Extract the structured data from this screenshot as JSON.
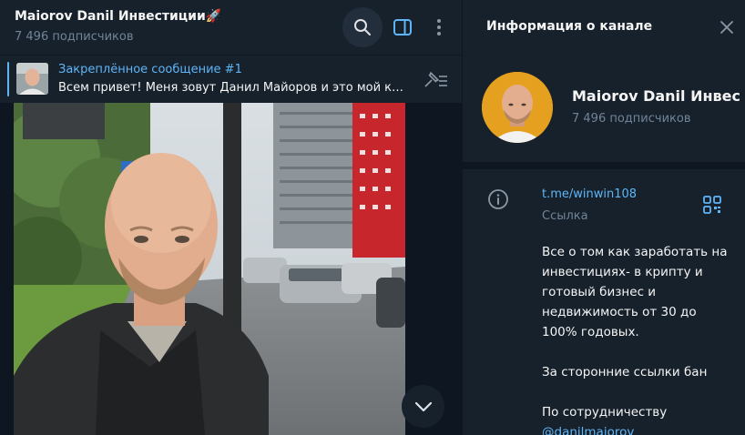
{
  "chat": {
    "title": "Maiorov Danil Инвестиции🚀",
    "subscribers": "7 496 подписчиков"
  },
  "pinned": {
    "title": "Закреплённое сообщение #1",
    "text": "Всем привет! Меня зовут Данил Майоров и это мой канал"
  },
  "info_panel": {
    "title": "Информация о канале",
    "name": "Maiorov Danil Инвестиции🚀",
    "subscribers": "7 496 подписчиков",
    "link": "t.me/winwin108",
    "link_label": "Ссылка",
    "description": [
      "Все о том как заработать на инвестициях- в крипту и готовый бизнес и недвижимость от 30 до 100% годовых.",
      "За сторонние ссылки бан",
      "По сотрудничеству"
    ],
    "mention": "@danilmaiorov"
  },
  "icons": [
    "search-icon",
    "sidebar-toggle-icon",
    "more-vertical-icon",
    "unpin-icon",
    "chevron-down-icon",
    "close-icon",
    "info-icon",
    "qr-code-icon"
  ],
  "colors": {
    "accent": "#5eb5f7",
    "panel_bg": "#17212b",
    "chat_bg": "#0e1621",
    "secondary_text": "#708499"
  }
}
